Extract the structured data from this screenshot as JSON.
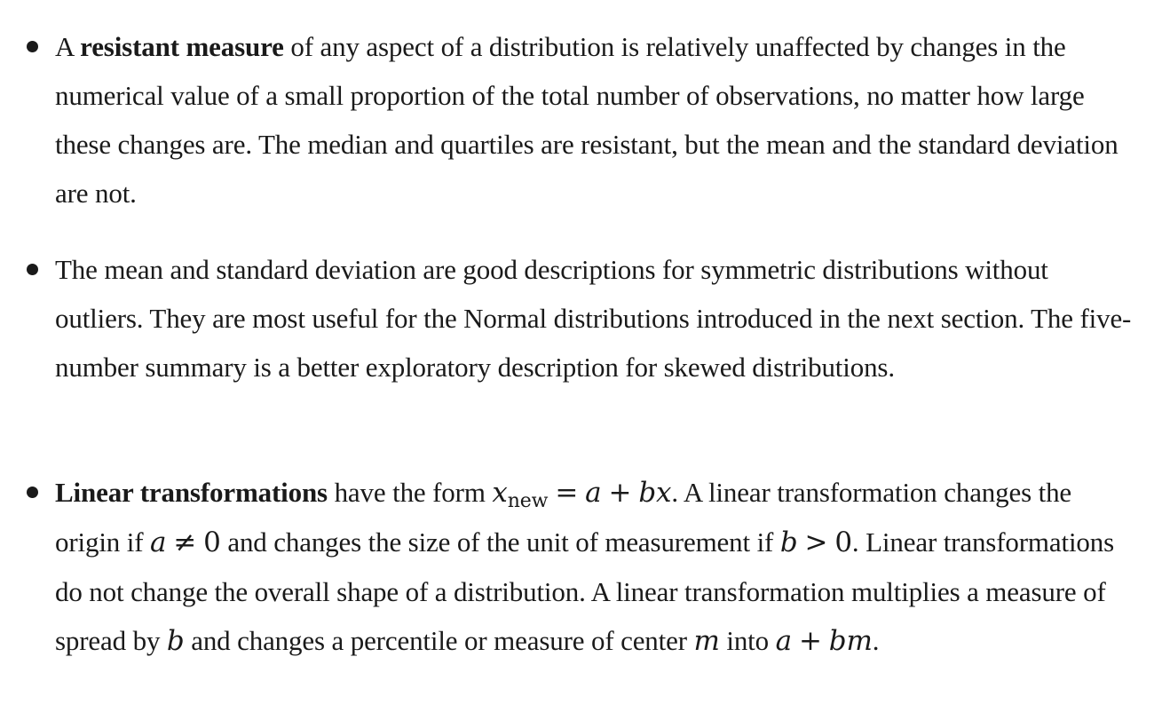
{
  "bullets": [
    {
      "term": "resistant measure",
      "lead": "A ",
      "text": " of any aspect of a distribution is relatively unaffected by changes in the numerical value of a small proportion of the total number of observations, no matter how large these changes are. The median and quartiles are resistant, but the mean and the standard deviation are not."
    },
    {
      "text": "The mean and standard deviation are good descriptions for symmetric distributions without outliers. They are most useful for the Normal distributions introduced in the next section. The five-number summary is a better exploratory description for skewed distributions."
    },
    {
      "term": "Linear transformations",
      "t1": " have the form ",
      "m1_var": "x",
      "m1_sub": "new",
      "m1_eq": "=",
      "m1_a": "a",
      "m1_plus": "+",
      "m1_bx": "bx",
      "t2": ". A linear transformation changes the origin if ",
      "m2_a": "a",
      "m2_neq": "≠",
      "m2_zero": "0",
      "t3": " and changes the size of the unit of measurement if ",
      "m3_b": "b",
      "m3_gt": ">",
      "m3_zero": "0",
      "t4": ". Linear transformations do not change the overall shape of a distribution. A linear transformation multiplies a measure of spread by ",
      "m4_b": "b",
      "t5": " and changes a percentile or measure of center ",
      "m5_m": "m",
      "t6": " into ",
      "m6_a": "a",
      "m6_plus": "+",
      "m6_bm": "bm",
      "t7": "."
    }
  ]
}
